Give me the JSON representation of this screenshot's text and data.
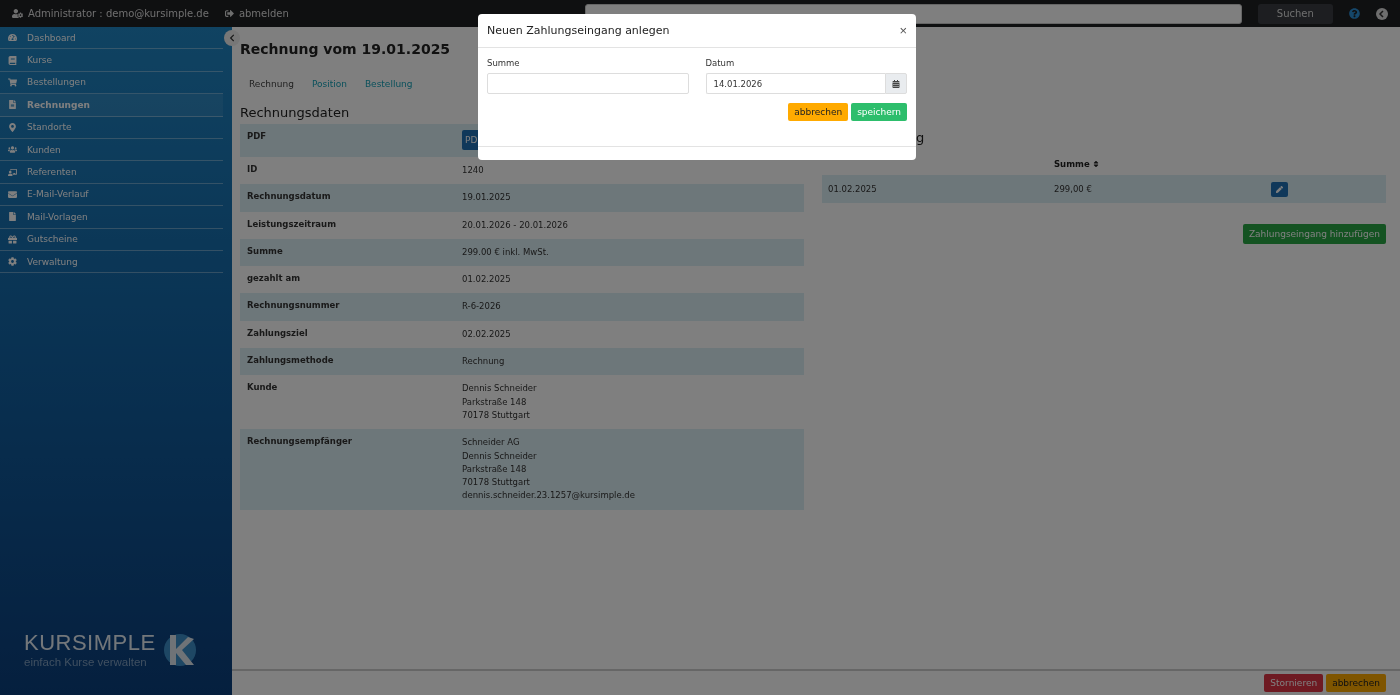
{
  "topbar": {
    "user": "Administrator : demo@kursimple.de",
    "logout": "abmelden",
    "search_button": "Suchen"
  },
  "sidebar": {
    "items": [
      {
        "label": "Dashboard",
        "selected": false
      },
      {
        "label": "Kurse",
        "selected": false
      },
      {
        "label": "Bestellungen",
        "selected": false
      },
      {
        "label": "Rechnungen",
        "selected": true
      },
      {
        "label": "Standorte",
        "selected": false
      },
      {
        "label": "Kunden",
        "selected": false
      },
      {
        "label": "Referenten",
        "selected": false
      },
      {
        "label": "E-Mail-Verlauf",
        "selected": false
      },
      {
        "label": "Mail-Vorlagen",
        "selected": false
      },
      {
        "label": "Gutscheine",
        "selected": false
      },
      {
        "label": "Verwaltung",
        "selected": false
      }
    ],
    "logo": {
      "name": "KURSIMPLE",
      "tagline": "einfach Kurse verwalten"
    }
  },
  "page": {
    "title": "Rechnung vom 19.01.2025",
    "tabs": [
      {
        "label": "Rechnung",
        "selected": true
      },
      {
        "label": "Position",
        "selected": false
      },
      {
        "label": "Bestellung",
        "selected": false
      }
    ],
    "details": {
      "heading": "Rechnungsdaten",
      "pdf_button": "PD",
      "rows": [
        {
          "label": "PDF",
          "kind": "button",
          "lines": []
        },
        {
          "label": "ID",
          "kind": "text",
          "lines": [
            "1240"
          ]
        },
        {
          "label": "Rechnungsdatum",
          "kind": "text",
          "lines": [
            "19.01.2025"
          ]
        },
        {
          "label": "Leistungszeitraum",
          "kind": "text",
          "lines": [
            "20.01.2026 - 20.01.2026"
          ]
        },
        {
          "label": "Summe",
          "kind": "text",
          "lines": [
            "299.00 € inkl. MwSt."
          ]
        },
        {
          "label": "gezahlt am",
          "kind": "text",
          "lines": [
            "01.02.2025"
          ]
        },
        {
          "label": "Rechnungsnummer",
          "kind": "text",
          "lines": [
            "R-6-2026"
          ]
        },
        {
          "label": "Zahlungsziel",
          "kind": "text",
          "lines": [
            "02.02.2025"
          ]
        },
        {
          "label": "Zahlungsmethode",
          "kind": "text",
          "lines": [
            "Rechnung"
          ]
        },
        {
          "label": "Kunde",
          "kind": "text",
          "lines": [
            "Dennis Schneider",
            "Parkstraße 148",
            "70178 Stuttgart"
          ]
        },
        {
          "label": "Rechnungsempfänger",
          "kind": "text",
          "lines": [
            "Schneider AG",
            "Dennis Schneider",
            "Parkstraße 148",
            "70178 Stuttgart",
            "dennis.schneider.23.1257@kursimple.de"
          ]
        }
      ]
    },
    "payments": {
      "heading": "g",
      "columns": [
        "Summe"
      ],
      "rows": [
        {
          "date": "01.02.2025",
          "sum": "299,00 €"
        }
      ],
      "add_button": "Zahlungseingang hinzufügen"
    },
    "footer_buttons": [
      {
        "label": "Stornieren",
        "kind": "danger"
      },
      {
        "label": "abbrechen",
        "kind": "warning"
      }
    ]
  },
  "modal": {
    "title": "Neuen Zahlungseingang anlegen",
    "close": "×",
    "fields": [
      {
        "label": "Summe",
        "kind": "text"
      },
      {
        "label": "Datum",
        "value": "14.01.2026",
        "kind": "date"
      }
    ],
    "buttons": [
      {
        "label": "abbrechen",
        "kind": "warning"
      },
      {
        "label": "speichern",
        "kind": "success"
      }
    ]
  }
}
